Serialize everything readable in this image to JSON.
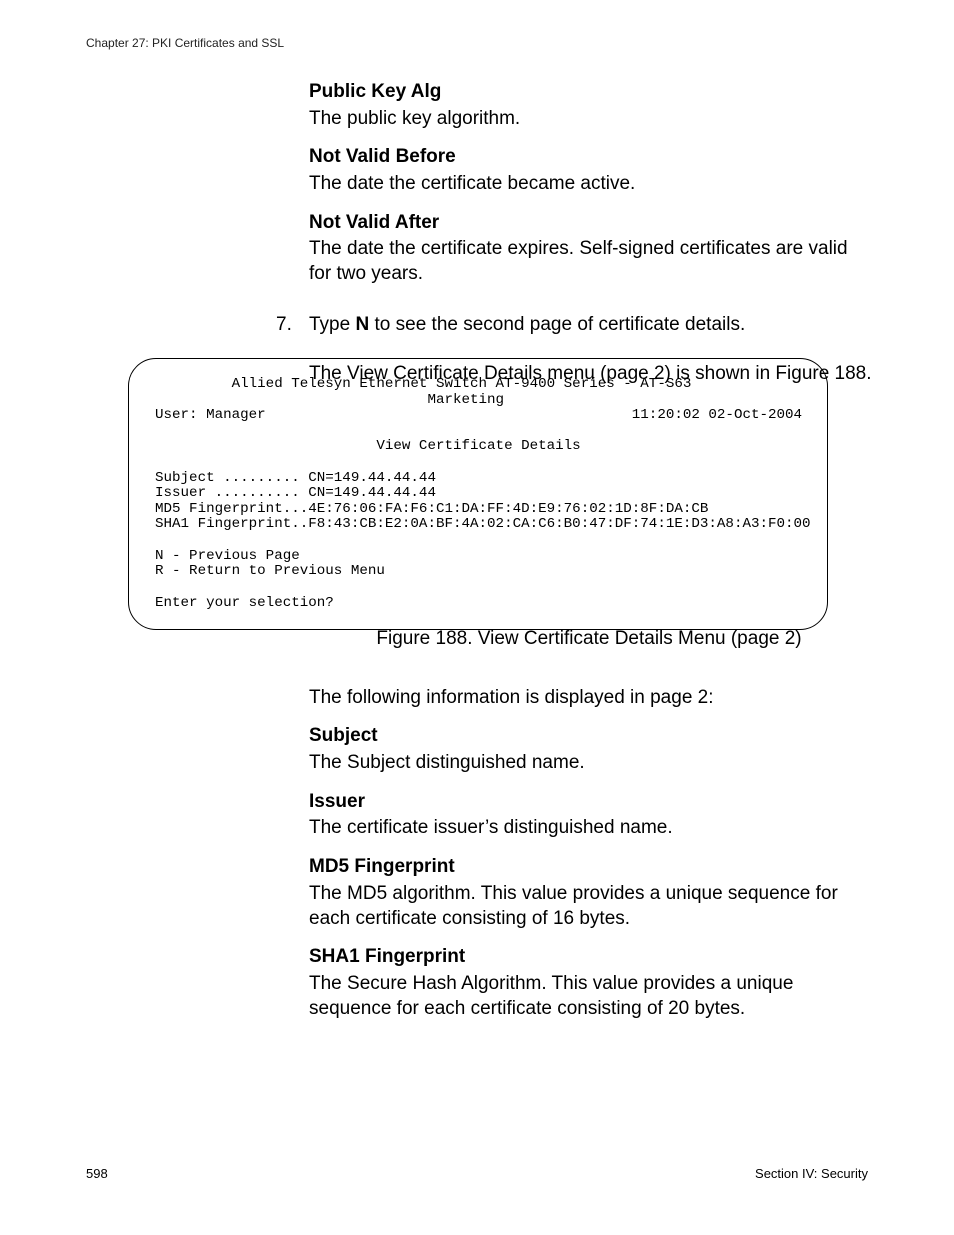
{
  "header": {
    "chapter": "Chapter 27: PKI Certificates and SSL"
  },
  "defs_top": {
    "public_key_alg": {
      "term": "Public Key Alg",
      "desc": "The public key algorithm."
    },
    "not_valid_before": {
      "term": "Not Valid Before",
      "desc": "The date the certificate became active."
    },
    "not_valid_after": {
      "term": "Not Valid After",
      "desc": "The date the certificate expires. Self-signed certificates are valid for two years."
    }
  },
  "step": {
    "number": "7.",
    "pre": "Type ",
    "key": "N",
    "post": " to see the second page of certificate details."
  },
  "lead_para": "The View Certificate Details menu (page 2) is shown in Figure 188.",
  "terminal": {
    "line1": "         Allied Telesyn Ethernet Switch AT-9400 Series - AT-S63",
    "line2": "                                Marketing",
    "line3": "User: Manager                                           11:20:02 02-Oct-2004",
    "blank1": " ",
    "line4": "                          View Certificate Details",
    "blank2": " ",
    "line5": " ",
    "line6": "Subject ......... CN=149.44.44.44",
    "line7": "Issuer .......... CN=149.44.44.44",
    "line8": "MD5 Fingerprint...4E:76:06:FA:F6:C1:DA:FF:4D:E9:76:02:1D:8F:DA:CB",
    "line9": "SHA1 Fingerprint..F8:43:CB:E2:0A:BF:4A:02:CA:C6:B0:47:DF:74:1E:D3:A8:A3:F0:00",
    "blank3": " ",
    "line10": "N - Previous Page",
    "line11": "R - Return to Previous Menu",
    "blank4": " ",
    "line12": "Enter your selection?"
  },
  "figure_caption": "Figure 188.  View Certificate Details Menu (page 2)",
  "after_para": "The following information is displayed in page 2:",
  "defs_bottom": {
    "subject": {
      "term": "Subject",
      "desc": "The Subject distinguished name."
    },
    "issuer": {
      "term": "Issuer",
      "desc": "The certificate issuer’s distinguished name."
    },
    "md5": {
      "term": "MD5 Fingerprint",
      "desc": "The MD5 algorithm. This value provides a unique sequence for each certificate consisting of 16 bytes."
    },
    "sha1": {
      "term": "SHA1 Fingerprint",
      "desc": "The Secure Hash Algorithm. This value provides a unique sequence for each certificate consisting of 20 bytes."
    }
  },
  "footer": {
    "page": "598",
    "section": "Section IV: Security"
  }
}
